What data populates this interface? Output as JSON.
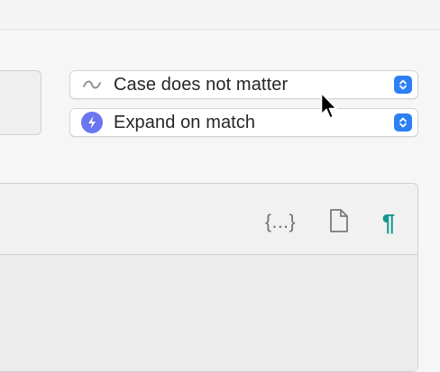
{
  "popups": [
    {
      "label": "Case does not matter",
      "icon": "tilde-icon"
    },
    {
      "label": "Expand on match",
      "icon": "lightning-bolt-icon"
    }
  ],
  "panel_toolbar": {
    "braces_label": "{...}",
    "document_icon": "document-icon",
    "pilcrow_label": "¶"
  },
  "colors": {
    "accent": "#2c7ff5",
    "bolt": "#6a75f0",
    "pilcrow": "#13998f"
  }
}
